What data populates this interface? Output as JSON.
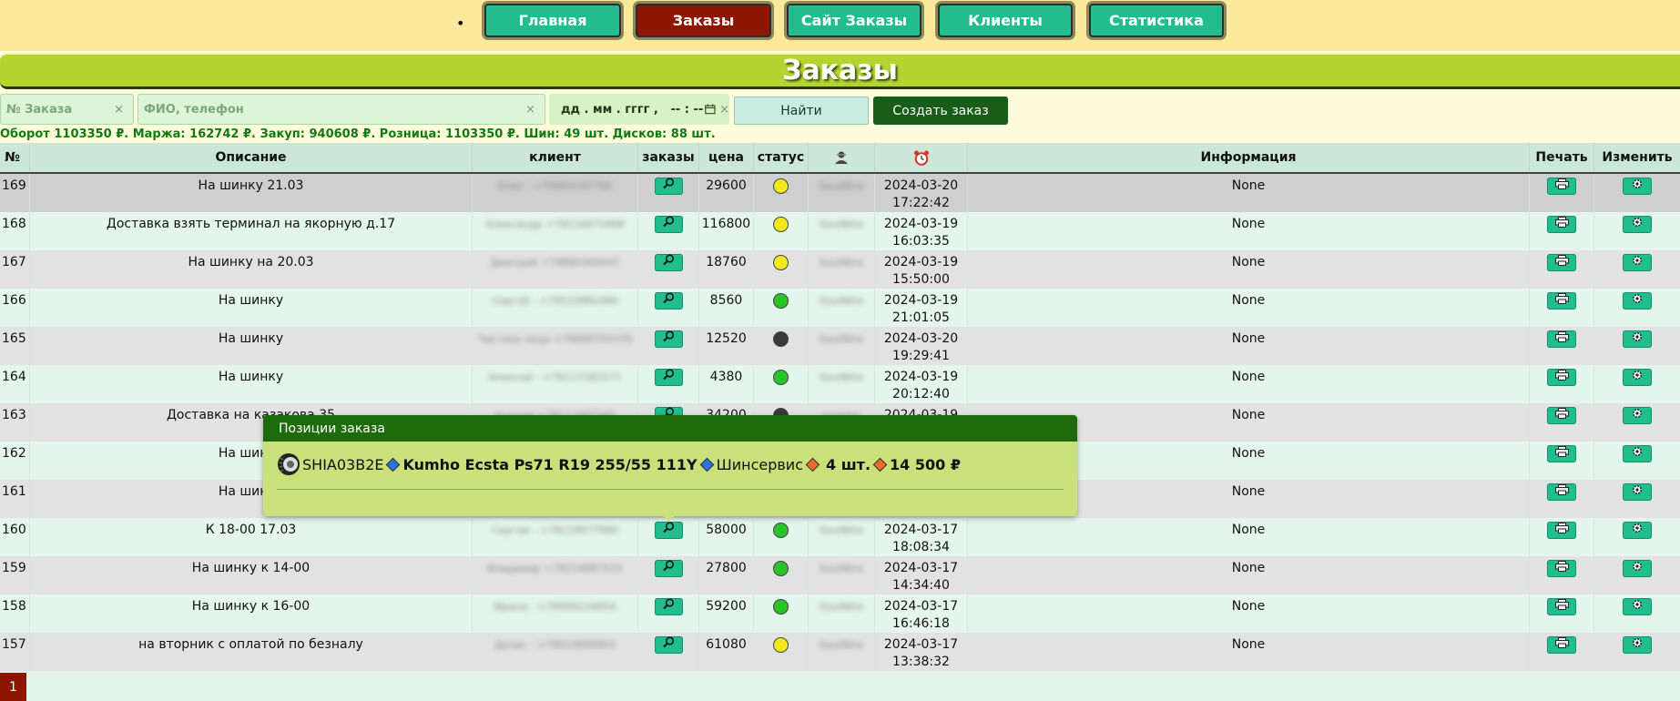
{
  "nav": {
    "bullet": "•",
    "items": [
      {
        "label": "Главная"
      },
      {
        "label": "Заказы"
      },
      {
        "label": "Сайт Заказы"
      },
      {
        "label": "Клиенты"
      },
      {
        "label": "Статистика"
      }
    ],
    "active_label": "Заказы"
  },
  "page_title": "Заказы",
  "filters": {
    "order_number_placeholder": "№ Заказа",
    "client_placeholder": "ФИО, телефон",
    "date_placeholder": "дд . мм . гггг ,   -- : --",
    "clear_symbol": "×",
    "find_label": "Найти",
    "create_label": "Создать заказ"
  },
  "stats": "Оборот 1103350 ₽. Маржа: 162742 ₽. Закуп: 940608 ₽. Розница: 1103350 ₽. Шин: 49 шт. Дисков: 88 шт.",
  "table": {
    "columns": {
      "num": "№",
      "description": "Описание",
      "client": "клиент",
      "orders": "заказы",
      "price": "цена",
      "status": "статус",
      "manager_icon": "user-icon",
      "date_icon": "alarm-clock-icon",
      "info": "Информация",
      "print": "Печать",
      "edit": "Изменить"
    },
    "rows": [
      {
        "num": "169",
        "description": "На шинку 21.03",
        "client": "Олег - +79993197780",
        "price": "29600",
        "status": "yellow",
        "manager": "SoulWire",
        "date": "2024-03-20",
        "time": "17:22:42",
        "info": "None"
      },
      {
        "num": "168",
        "description": "Доставка взять терминал на якорную д.17",
        "client": "Александр +79116971908",
        "price": "116800",
        "status": "yellow",
        "manager": "SoulWire",
        "date": "2024-03-19",
        "time": "16:03:35",
        "info": "None"
      },
      {
        "num": "167",
        "description": "На шинку на 20.03",
        "client": "Дмитрий +79880300047",
        "price": "18760",
        "status": "yellow",
        "manager": "SoulWire",
        "date": "2024-03-19",
        "time": "15:50:00",
        "info": "None"
      },
      {
        "num": "166",
        "description": "На шинку",
        "client": "Сергей - +79533982480",
        "price": "8560",
        "status": "green",
        "manager": "SoulWire",
        "date": "2024-03-19",
        "time": "21:01:05",
        "info": "None"
      },
      {
        "num": "165",
        "description": "На шинку",
        "client": "Частное лицо +79889783378",
        "price": "12520",
        "status": "black",
        "manager": "SoulWire",
        "date": "2024-03-20",
        "time": "19:29:41",
        "info": "None"
      },
      {
        "num": "164",
        "description": "На шинку",
        "client": "Алексей - +79117181577",
        "price": "4380",
        "status": "green",
        "manager": "SoulWire",
        "date": "2024-03-19",
        "time": "20:12:40",
        "info": "None"
      },
      {
        "num": "163",
        "description": "Доставка на казакова 35",
        "client": "Андрей +79111002345",
        "price": "34200",
        "status": "black",
        "manager": "pvzplex",
        "date": "2024-03-19",
        "time": "",
        "info": "None"
      },
      {
        "num": "162",
        "description": "На шинку",
        "client": "",
        "price": "",
        "status": "",
        "manager": "",
        "date": "",
        "time": "",
        "info": "None"
      },
      {
        "num": "161",
        "description": "На шинку",
        "client": "",
        "price": "",
        "status": "",
        "manager": "",
        "date": "",
        "time": "",
        "info": "None"
      },
      {
        "num": "160",
        "description": "К 18-00 17.03",
        "client": "Сергей - +79119977990",
        "price": "58000",
        "status": "green",
        "manager": "SoulWire",
        "date": "2024-03-17",
        "time": "18:08:34",
        "info": "None"
      },
      {
        "num": "159",
        "description": "На шинку к 14-00",
        "client": "Владимир +79214887533",
        "price": "27800",
        "status": "green",
        "manager": "SoulWire",
        "date": "2024-03-17",
        "time": "14:34:40",
        "info": "None"
      },
      {
        "num": "158",
        "description": "На шинку к 16-00",
        "client": "Ирина - +79000216854",
        "price": "59200",
        "status": "green",
        "manager": "SoulWire",
        "date": "2024-03-17",
        "time": "16:46:18",
        "info": "None"
      },
      {
        "num": "157",
        "description": "на вторник с оплатой по безналу",
        "client": "Денис - +79019899903",
        "price": "61080",
        "status": "yellow",
        "manager": "SoulWire",
        "date": "2024-03-17",
        "time": "13:38:32",
        "info": "None"
      }
    ]
  },
  "popover": {
    "title": "Позиции заказа",
    "sku": "SHIA03B2E",
    "product": "Kumho Ecsta Ps71 R19 255/55 111Y",
    "supplier": "Шинсервис",
    "qty": "4 шт.",
    "price": "14 500 ₽"
  },
  "pager": {
    "current": "1"
  },
  "colors": {
    "nav_bg": "#fae99a",
    "nav_btn": "#21bd8c",
    "nav_active": "#8e1600",
    "title_bar": "#b6d430",
    "popover_head": "#1e6b0c",
    "popover_body": "#c8e17a",
    "create_btn": "#195c17"
  }
}
